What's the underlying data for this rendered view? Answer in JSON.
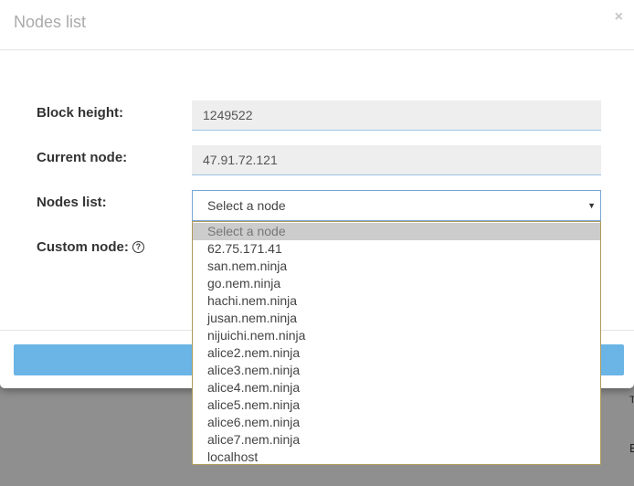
{
  "modal": {
    "title": "Nodes list",
    "close_symbol": "×"
  },
  "form": {
    "block_height_label": "Block height:",
    "block_height_value": "1249522",
    "current_node_label": "Current node:",
    "current_node_value": "47.91.72.121",
    "nodes_list_label": "Nodes list:",
    "nodes_list_selected": "Select a node",
    "custom_node_label": "Custom node:",
    "help_icon_glyph": "?"
  },
  "dropdown": {
    "arrow_glyph": "▼",
    "options": [
      "Select a node",
      "62.75.171.41",
      "san.nem.ninja",
      "go.nem.ninja",
      "hachi.nem.ninja",
      "jusan.nem.ninja",
      "nijuichi.nem.ninja",
      "alice2.nem.ninja",
      "alice3.nem.ninja",
      "alice4.nem.ninja",
      "alice5.nem.ninja",
      "alice6.nem.ninja",
      "alice7.nem.ninja",
      "localhost"
    ]
  },
  "backdrop": {
    "text_1": "T",
    "text_2": "E"
  },
  "colors": {
    "button_blue": "#6ab4e6",
    "input_bg": "#eeeeee",
    "backdrop": "#8f8f8f"
  }
}
